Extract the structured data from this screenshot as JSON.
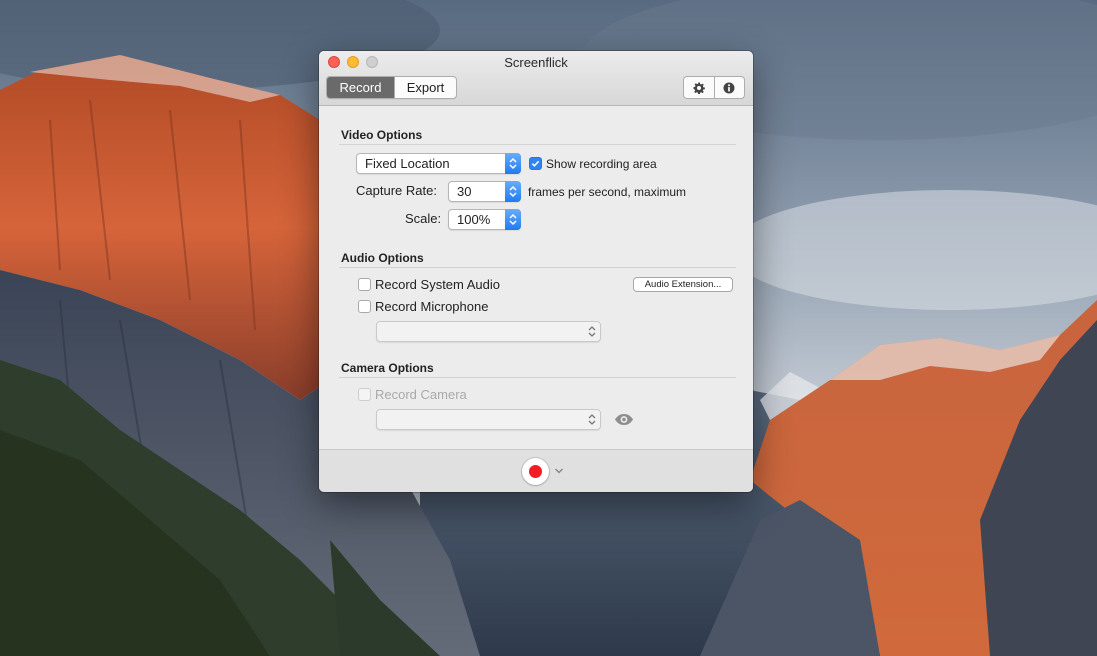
{
  "window": {
    "title": "Screenflick",
    "tabs": [
      "Record",
      "Export"
    ],
    "active_tab": "Record",
    "toolbar_icons": [
      "gear-icon",
      "info-icon"
    ]
  },
  "video": {
    "section_title": "Video Options",
    "mode_value": "Fixed Location",
    "show_area_label": "Show recording area",
    "show_area_checked": true,
    "capture_rate_label": "Capture Rate:",
    "capture_rate_value": "30",
    "capture_rate_suffix": "frames per second, maximum",
    "scale_label": "Scale:",
    "scale_value": "100%"
  },
  "audio": {
    "section_title": "Audio Options",
    "system_audio_label": "Record System Audio",
    "system_audio_checked": false,
    "microphone_label": "Record Microphone",
    "microphone_checked": false,
    "extension_button_label": "Audio Extension...",
    "microphone_source_value": ""
  },
  "camera": {
    "section_title": "Camera Options",
    "record_camera_label": "Record Camera",
    "record_camera_checked": false,
    "record_camera_enabled": false,
    "camera_source_value": "",
    "preview_icon": "eye-icon"
  },
  "footer": {
    "record_icon": "record-icon",
    "menu_icon": "chevron-down-icon"
  },
  "colors": {
    "accent": "#2f84f5",
    "record_red": "#f11c24",
    "window_bg": "#ececec"
  }
}
